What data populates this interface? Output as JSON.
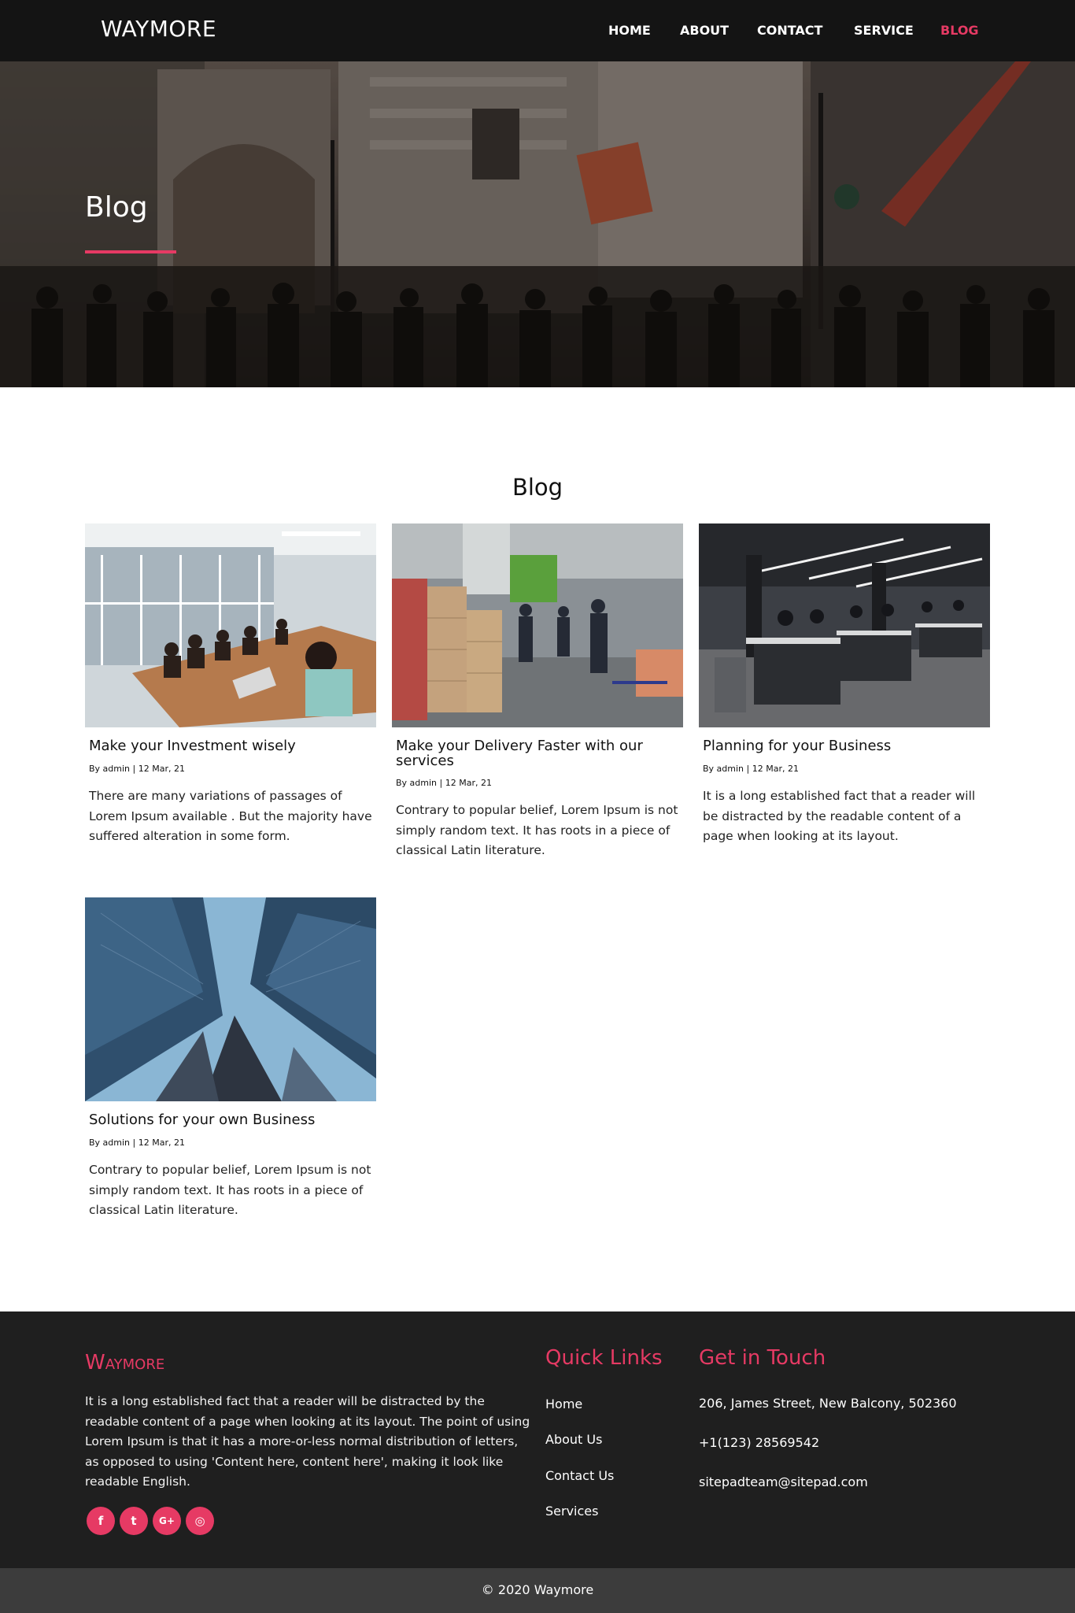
{
  "nav": {
    "brand": "WAYMORE",
    "items": [
      {
        "label": "HOME",
        "active": false
      },
      {
        "label": "ABOUT",
        "active": false
      },
      {
        "label": "CONTACT",
        "active": false
      },
      {
        "label": "SERVICE",
        "active": false
      },
      {
        "label": "BLOG",
        "active": true
      }
    ]
  },
  "hero": {
    "title": "Blog"
  },
  "section": {
    "title": "Blog"
  },
  "posts": [
    {
      "title": "Make your Investment wisely",
      "meta": "By admin | 12 Mar, 21",
      "text": "There are many variations of passages of Lorem Ipsum available . But the majority have suffered alteration in some form."
    },
    {
      "title": "Make your Delivery Faster with our services",
      "meta": "By admin | 12 Mar, 21",
      "text": "Contrary to popular belief, Lorem Ipsum is not simply random text. It has roots in a piece of classical Latin literature."
    },
    {
      "title": "Planning for your Business",
      "meta": "By admin | 12 Mar, 21",
      "text": "It is a long established fact that a reader will be distracted by the readable content of a page when looking at its layout."
    },
    {
      "title": "Solutions for your own Business",
      "meta": "By admin | 12 Mar, 21",
      "text": "Contrary to popular belief, Lorem Ipsum is not simply random text. It has roots in a piece of classical Latin literature."
    }
  ],
  "footer": {
    "brand": "Waymore",
    "description": "It is a long established fact that a reader will be distracted by the readable content of a page when looking at its layout. The point of using Lorem Ipsum is that it has a more-or-less normal distribution of letters, as opposed to using 'Content here, content here', making it look like readable English.",
    "social": [
      {
        "icon": "facebook-icon",
        "glyph": "f"
      },
      {
        "icon": "twitter-icon",
        "glyph": "t"
      },
      {
        "icon": "google-plus-icon",
        "glyph": "G+"
      },
      {
        "icon": "instagram-icon",
        "glyph": "◎"
      }
    ],
    "quick_links_title": "Quick Links",
    "quick_links": [
      "Home",
      "About Us",
      "Contact Us",
      "Services"
    ],
    "contact_title": "Get in Touch",
    "contact": [
      "206, James Street, New Balcony, 502360",
      "+1(123) 28569542",
      "sitepadteam@sitepad.com"
    ],
    "copyright": "© 2020 Waymore"
  },
  "colors": {
    "accent": "#e63a64",
    "nav_bg": "#141414",
    "footer_bg": "#1f1f1f",
    "copyright_bg": "#3c3c3c"
  }
}
